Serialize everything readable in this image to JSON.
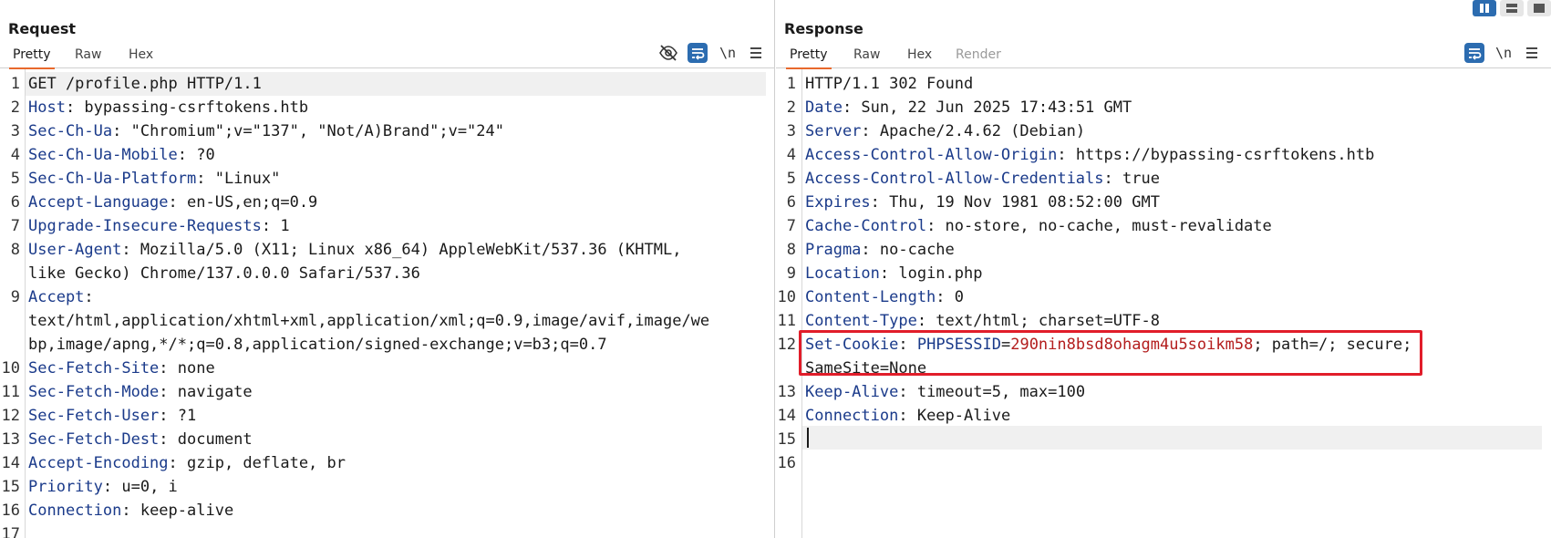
{
  "request": {
    "title": "Request",
    "tabs": [
      "Pretty",
      "Raw",
      "Hex"
    ],
    "active_tab": "Pretty",
    "tools": {
      "eye_icon": "eye-off-icon",
      "wrap_icon": "word-wrap-icon",
      "newline_label": "\\n",
      "menu_icon": "hamburger-menu-icon"
    },
    "lines": [
      {
        "n": "1",
        "key": "",
        "text": "GET /profile.php HTTP/1.1"
      },
      {
        "n": "2",
        "key": "Host",
        "text": ": bypassing-csrftokens.htb"
      },
      {
        "n": "3",
        "key": "Sec-Ch-Ua",
        "text": ": \"Chromium\";v=\"137\", \"Not/A)Brand\";v=\"24\""
      },
      {
        "n": "4",
        "key": "Sec-Ch-Ua-Mobile",
        "text": ": ?0"
      },
      {
        "n": "5",
        "key": "Sec-Ch-Ua-Platform",
        "text": ": \"Linux\""
      },
      {
        "n": "6",
        "key": "Accept-Language",
        "text": ": en-US,en;q=0.9"
      },
      {
        "n": "7",
        "key": "Upgrade-Insecure-Requests",
        "text": ": 1"
      },
      {
        "n": "8",
        "key": "User-Agent",
        "text": ": Mozilla/5.0 (X11; Linux x86_64) AppleWebKit/537.36 (KHTML,"
      },
      {
        "n": "",
        "key": "",
        "text": "like Gecko) Chrome/137.0.0.0 Safari/537.36"
      },
      {
        "n": "9",
        "key": "Accept",
        "text": ":"
      },
      {
        "n": "",
        "key": "",
        "text": "text/html,application/xhtml+xml,application/xml;q=0.9,image/avif,image/we"
      },
      {
        "n": "",
        "key": "",
        "text": "bp,image/apng,*/*;q=0.8,application/signed-exchange;v=b3;q=0.7"
      },
      {
        "n": "10",
        "key": "Sec-Fetch-Site",
        "text": ": none"
      },
      {
        "n": "11",
        "key": "Sec-Fetch-Mode",
        "text": ": navigate"
      },
      {
        "n": "12",
        "key": "Sec-Fetch-User",
        "text": ": ?1"
      },
      {
        "n": "13",
        "key": "Sec-Fetch-Dest",
        "text": ": document"
      },
      {
        "n": "14",
        "key": "Accept-Encoding",
        "text": ": gzip, deflate, br"
      },
      {
        "n": "15",
        "key": "Priority",
        "text": ": u=0, i"
      },
      {
        "n": "16",
        "key": "Connection",
        "text": ": keep-alive"
      },
      {
        "n": "17",
        "key": "",
        "text": ""
      }
    ]
  },
  "response": {
    "title": "Response",
    "tabs": [
      "Pretty",
      "Raw",
      "Hex",
      "Render"
    ],
    "active_tab": "Pretty",
    "disabled_tab": "Render",
    "tools": {
      "wrap_icon": "word-wrap-icon",
      "newline_label": "\\n",
      "menu_icon": "hamburger-menu-icon"
    },
    "lines": [
      {
        "n": "1",
        "key": "",
        "text": "HTTP/1.1 302 Found"
      },
      {
        "n": "2",
        "key": "Date",
        "text": ": Sun, 22 Jun 2025 17:43:51 GMT"
      },
      {
        "n": "3",
        "key": "Server",
        "text": ": Apache/2.4.62 (Debian)"
      },
      {
        "n": "4",
        "key": "Access-Control-Allow-Origin",
        "text": ": https://bypassing-csrftokens.htb"
      },
      {
        "n": "5",
        "key": "Access-Control-Allow-Credentials",
        "text": ": true"
      },
      {
        "n": "6",
        "key": "Expires",
        "text": ": Thu, 19 Nov 1981 08:52:00 GMT"
      },
      {
        "n": "7",
        "key": "Cache-Control",
        "text": ": no-store, no-cache, must-revalidate"
      },
      {
        "n": "8",
        "key": "Pragma",
        "text": ": no-cache"
      },
      {
        "n": "9",
        "key": "Location",
        "text": ": login.php"
      },
      {
        "n": "10",
        "key": "Content-Length",
        "text": ": 0"
      },
      {
        "n": "11",
        "key": "Content-Type",
        "text": ": text/html; charset=UTF-8"
      },
      {
        "n": "12",
        "key": "Set-Cookie",
        "text": ": ",
        "cookie_name": "PHPSESSID",
        "cookie_eq": "=",
        "cookie_value": "290nin8bsd8ohagm4u5soikm58",
        "rest": "; path=/; secure;"
      },
      {
        "n": "",
        "key": "",
        "text": "SameSite=None"
      },
      {
        "n": "13",
        "key": "Keep-Alive",
        "text": ": timeout=5, max=100"
      },
      {
        "n": "14",
        "key": "Connection",
        "text": ": Keep-Alive"
      },
      {
        "n": "15",
        "key": "",
        "text": ""
      },
      {
        "n": "16",
        "key": "",
        "text": ""
      }
    ]
  },
  "layout_toggle": [
    "split-vertical-icon",
    "split-horizontal-icon",
    "single-pane-icon"
  ],
  "colors": {
    "accent_tab": "#e8692c",
    "header_key": "#1a3a8a",
    "cookie_value": "#b31d1d",
    "highlight_box": "#e11d2a",
    "tool_blue": "#2c6cb0"
  }
}
